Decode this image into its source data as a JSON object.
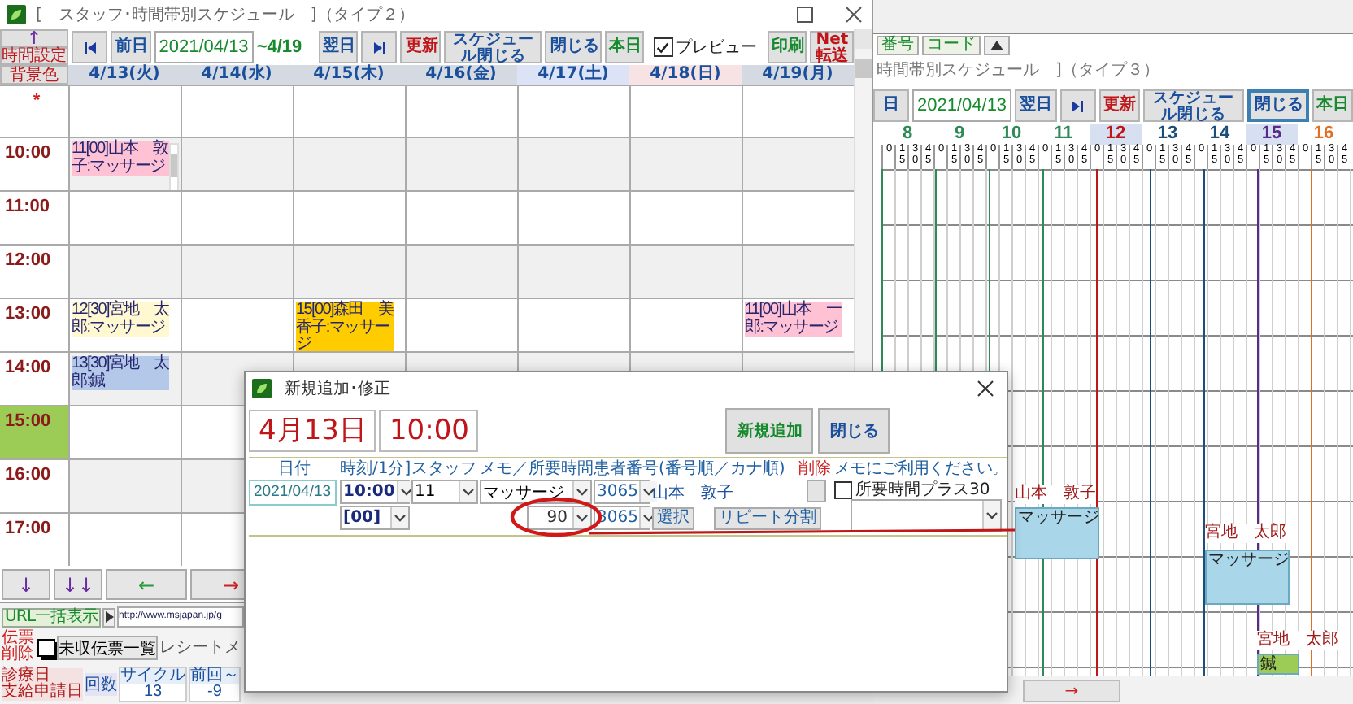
{
  "left_window": {
    "title": "[　スタッフ･時間帯別スケジュール　]（タイプ２）",
    "side_buttons": [
      {
        "label": "↑",
        "color": "#6a2aa0"
      },
      {
        "label": "時間設定",
        "color": "#c0161a"
      },
      {
        "label": "背景色",
        "color": "#c0161a"
      }
    ],
    "toolbar": [
      {
        "kind": "jump_first"
      },
      {
        "kind": "button",
        "label": "前日",
        "color": "#1a4f9c"
      },
      {
        "kind": "date",
        "value": "2021/04/13"
      },
      {
        "kind": "range",
        "label": "~4/19"
      },
      {
        "kind": "button",
        "label": "翌日",
        "color": "#1a4f9c"
      },
      {
        "kind": "jump_last"
      },
      {
        "kind": "button",
        "label": "更新",
        "color": "#c0161a"
      },
      {
        "kind": "button",
        "label": "スケジュール閉じる",
        "color": "#1a4f9c"
      },
      {
        "kind": "button",
        "label": "閉じる",
        "color": "#1a4f9c"
      },
      {
        "kind": "button",
        "label": "本日",
        "color": "#178a2e"
      },
      {
        "kind": "checkbox",
        "label": "プレビュー",
        "checked": true
      },
      {
        "kind": "button",
        "label": "印刷",
        "color": "#178a2e"
      },
      {
        "kind": "button",
        "label": "Net転送",
        "color": "#c0161a"
      }
    ],
    "days": [
      {
        "label": "4/13(火)",
        "color": "#d5dae2"
      },
      {
        "label": "4/14(水)",
        "color": "#d5dae2"
      },
      {
        "label": "4/15(木)",
        "color": "#d5dae2"
      },
      {
        "label": "4/16(金)",
        "color": "#d5dae2"
      },
      {
        "label": "4/17(土)",
        "color": "#dde3f6"
      },
      {
        "label": "4/18(日)",
        "color": "#f7e2e4"
      },
      {
        "label": "4/19(月)",
        "color": "#d5dae2"
      }
    ],
    "rows": [
      {
        "time": "*",
        "highlighted": false,
        "cells": [
          {},
          {},
          {},
          {},
          {},
          {},
          {}
        ]
      },
      {
        "time": "10:00",
        "highlighted": false,
        "cells": [
          {
            "text": "11[00]山本　敦子:マッサージ",
            "color": "#ffc2d4",
            "scrollable": true
          },
          {},
          {},
          {},
          {},
          {},
          {}
        ]
      },
      {
        "time": "11:00",
        "highlighted": false,
        "cells": [
          {},
          {},
          {},
          {},
          {},
          {},
          {}
        ]
      },
      {
        "time": "12:00",
        "highlighted": false,
        "cells": [
          {},
          {},
          {},
          {},
          {},
          {},
          {}
        ]
      },
      {
        "time": "13:00",
        "highlighted": false,
        "cells": [
          {
            "text": "12[30]宮地　太郎:マッサージ",
            "color": "#fff8d0",
            "scrollable": false
          },
          {},
          {
            "text": "15[00]森田　美香子:マッサージ",
            "color": "#ffcc00",
            "scrollable": false
          },
          {},
          {},
          {},
          {
            "text": "11[00]山本　一郎:マッサージ",
            "color": "#ffc2d4",
            "scrollable": false
          }
        ]
      },
      {
        "time": "14:00",
        "highlighted": false,
        "cells": [
          {
            "text": "13[30]宮地　太郎:鍼",
            "color": "#b4c8ea",
            "scrollable": false
          },
          {},
          {},
          {},
          {},
          {},
          {}
        ]
      },
      {
        "time": "15:00",
        "highlighted": true,
        "cells": [
          {},
          {},
          {},
          {},
          {},
          {},
          {}
        ]
      },
      {
        "time": "16:00",
        "highlighted": false,
        "cells": [
          {},
          {},
          {},
          {},
          {},
          {},
          {}
        ]
      },
      {
        "time": "17:00",
        "highlighted": false,
        "cells": [
          {},
          {},
          {},
          {},
          {},
          {},
          {}
        ]
      }
    ],
    "bottom_buttons": [
      {
        "label": "↓",
        "color": "#6a2aa0"
      },
      {
        "label": "↓↓",
        "color": "#6a2aa0"
      },
      {
        "label": "←",
        "color": "#2a9a3a"
      },
      {
        "label": "→",
        "color": "#d02020"
      }
    ]
  },
  "right_window": {
    "tabs": [
      {
        "label": "番号"
      },
      {
        "label": "コード"
      }
    ],
    "title": "時間帯別スケジュール　]（タイプ３）",
    "toolbar": [
      {
        "kind": "button",
        "label": "日",
        "color": "#1a4f9c",
        "focused": false
      },
      {
        "kind": "date",
        "value": "2021/04/13"
      },
      {
        "kind": "button",
        "label": "翌日",
        "color": "#1a4f9c",
        "focused": false
      },
      {
        "kind": "jump_last"
      },
      {
        "kind": "button",
        "label": "更新",
        "color": "#c0161a",
        "focused": false
      },
      {
        "kind": "button",
        "label": "スケジュール閉じる",
        "color": "#1a4f9c",
        "focused": false
      },
      {
        "kind": "button",
        "label": "閉じる",
        "color": "#1a4f9c",
        "focused": true
      },
      {
        "kind": "button",
        "label": "本日",
        "color": "#178a2e",
        "focused": false
      }
    ],
    "hours": [
      {
        "label": "8",
        "color": "#2e8b57",
        "highlighted": false,
        "subticks": [
          "0",
          "15",
          "30",
          "45"
        ]
      },
      {
        "label": "9",
        "color": "#2e8b57",
        "highlighted": false,
        "subticks": [
          "0",
          "15",
          "30",
          "45"
        ]
      },
      {
        "label": "10",
        "color": "#2e8b57",
        "highlighted": false,
        "subticks": [
          "0",
          "15",
          "30",
          "45"
        ]
      },
      {
        "label": "11",
        "color": "#2e8b57",
        "highlighted": false,
        "subticks": [
          "0",
          "15",
          "30",
          "45"
        ]
      },
      {
        "label": "12",
        "color": "#c0161a",
        "highlighted": true,
        "subticks": [
          "0",
          "15",
          "30",
          "45"
        ]
      },
      {
        "label": "13",
        "color": "#1a4f7c",
        "highlighted": false,
        "subticks": [
          "0",
          "15",
          "30",
          "45"
        ]
      },
      {
        "label": "14",
        "color": "#1a4f7c",
        "highlighted": false,
        "subticks": [
          "0",
          "15",
          "30",
          "45"
        ]
      },
      {
        "label": "15",
        "color": "#5a2a8a",
        "highlighted": true,
        "subticks": [
          "0",
          "15",
          "30",
          "45"
        ]
      },
      {
        "label": "16",
        "color": "#e07020",
        "highlighted": false,
        "subticks": [
          "0",
          "15",
          "30",
          "45"
        ]
      }
    ],
    "events": [
      {
        "kind": "label",
        "text": "山本　敦子"
      },
      {
        "kind": "block",
        "text": "マッサージ",
        "color": "#a9d6e8"
      },
      {
        "kind": "label",
        "text": "宮地　太郎"
      },
      {
        "kind": "block",
        "text": "マッサージ",
        "color": "#a9d6e8"
      },
      {
        "kind": "label",
        "text": "宮地　太郎"
      },
      {
        "kind": "block",
        "text": "鍼",
        "color": "#9ccc55"
      }
    ],
    "bottom_button": "→"
  },
  "dialog": {
    "title": "新規追加･修正",
    "date_display": "4月13日",
    "time_display": "10:00",
    "buttons": [
      {
        "label": "新規追加",
        "color": "#178a2e"
      },
      {
        "label": "閉じる",
        "color": "#1a4f9c"
      }
    ],
    "labels": [
      {
        "text": "日付",
        "color": "#2060a0"
      },
      {
        "text": "時刻/1分]",
        "color": "#2060a0"
      },
      {
        "text": "スタッフ",
        "color": "#2060a0"
      },
      {
        "text": "メモ／所要時間",
        "color": "#2060a0"
      },
      {
        "text": "患者番号(番号順／カナ順)",
        "color": "#2060a0"
      },
      {
        "text": "削除",
        "color": "#d02020"
      },
      {
        "text": "メモにご利用ください。",
        "color": "#2060a0"
      }
    ],
    "date": "2021/04/13",
    "time": "10:00",
    "staff": "11",
    "memo": "マッサージ",
    "patient_number": "3065",
    "patient_name": "山本　敦子",
    "extra_time": {
      "label": "所要時間プラス30",
      "checked": false
    },
    "minute": "[00]",
    "duration": "90",
    "patient_number_2": "3065",
    "select_button": "選択",
    "repeat_button": "リピート分割"
  },
  "bottom_panel": {
    "url_button": "URL一括表示",
    "url": "http://www.msjapan.jp/g",
    "delete_label": "伝票削除",
    "delete_checked": false,
    "unpaid_button": "未収伝票一覧",
    "receipt_label": "レシートメ",
    "date_labels": [
      "診療日",
      "支給申請日"
    ],
    "count_label": "回数",
    "cycle": {
      "label": "サイクル",
      "value": "13"
    },
    "previous": {
      "label": "前回～",
      "value": "-9"
    }
  }
}
